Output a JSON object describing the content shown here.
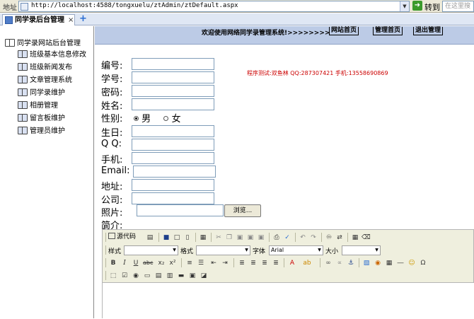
{
  "browser": {
    "address_label": "地址",
    "url": "http://localhost:4588/tongxuelu/ztAdmin/ztDefault.aspx",
    "go_label": "转到",
    "search_placeholder": "在这里搜",
    "tab_title": "同学录后台管理",
    "tab_close": "×",
    "new_tab": "+"
  },
  "sidebar": {
    "root": "同学录网站后台管理",
    "items": [
      {
        "label": "班级基本信息修改"
      },
      {
        "label": "班级新闻发布"
      },
      {
        "label": "文章管理系统"
      },
      {
        "label": "同学录维护"
      },
      {
        "label": "相册管理"
      },
      {
        "label": "留言板维护"
      },
      {
        "label": "管理员维护"
      }
    ]
  },
  "header": {
    "welcome": "欢迎使用网络同学录管理系统!>>>>>>>>",
    "links": [
      "网站首页",
      "管理首页",
      "退出管理"
    ]
  },
  "contact": "程序测试:双鱼林 QQ:287307421 手机:13558690869",
  "form": {
    "fields": [
      {
        "label": "编号:",
        "value": ""
      },
      {
        "label": "学号:",
        "value": ""
      },
      {
        "label": "密码:",
        "value": ""
      },
      {
        "label": "姓名:",
        "value": ""
      }
    ],
    "gender": {
      "label": "性别:",
      "option_male": "男",
      "option_female": "女",
      "selected": "男"
    },
    "fields2": [
      {
        "label": "生日:",
        "value": ""
      },
      {
        "label": "Q Q:",
        "value": ""
      },
      {
        "label": "手机:",
        "value": ""
      },
      {
        "label": "Email:",
        "value": ""
      },
      {
        "label": "地址:",
        "value": ""
      },
      {
        "label": "公司:",
        "value": ""
      }
    ],
    "photo_label": "照片:",
    "browse_label": "浏览...",
    "intro_label": "简介:"
  },
  "editor": {
    "source_label": "源代码",
    "style_label": "样式",
    "format_label": "格式",
    "font_label": "字体",
    "font_value": "Arial",
    "size_label": "大小",
    "bold": "B",
    "italic": "I",
    "underline": "U",
    "strike": "abc"
  }
}
